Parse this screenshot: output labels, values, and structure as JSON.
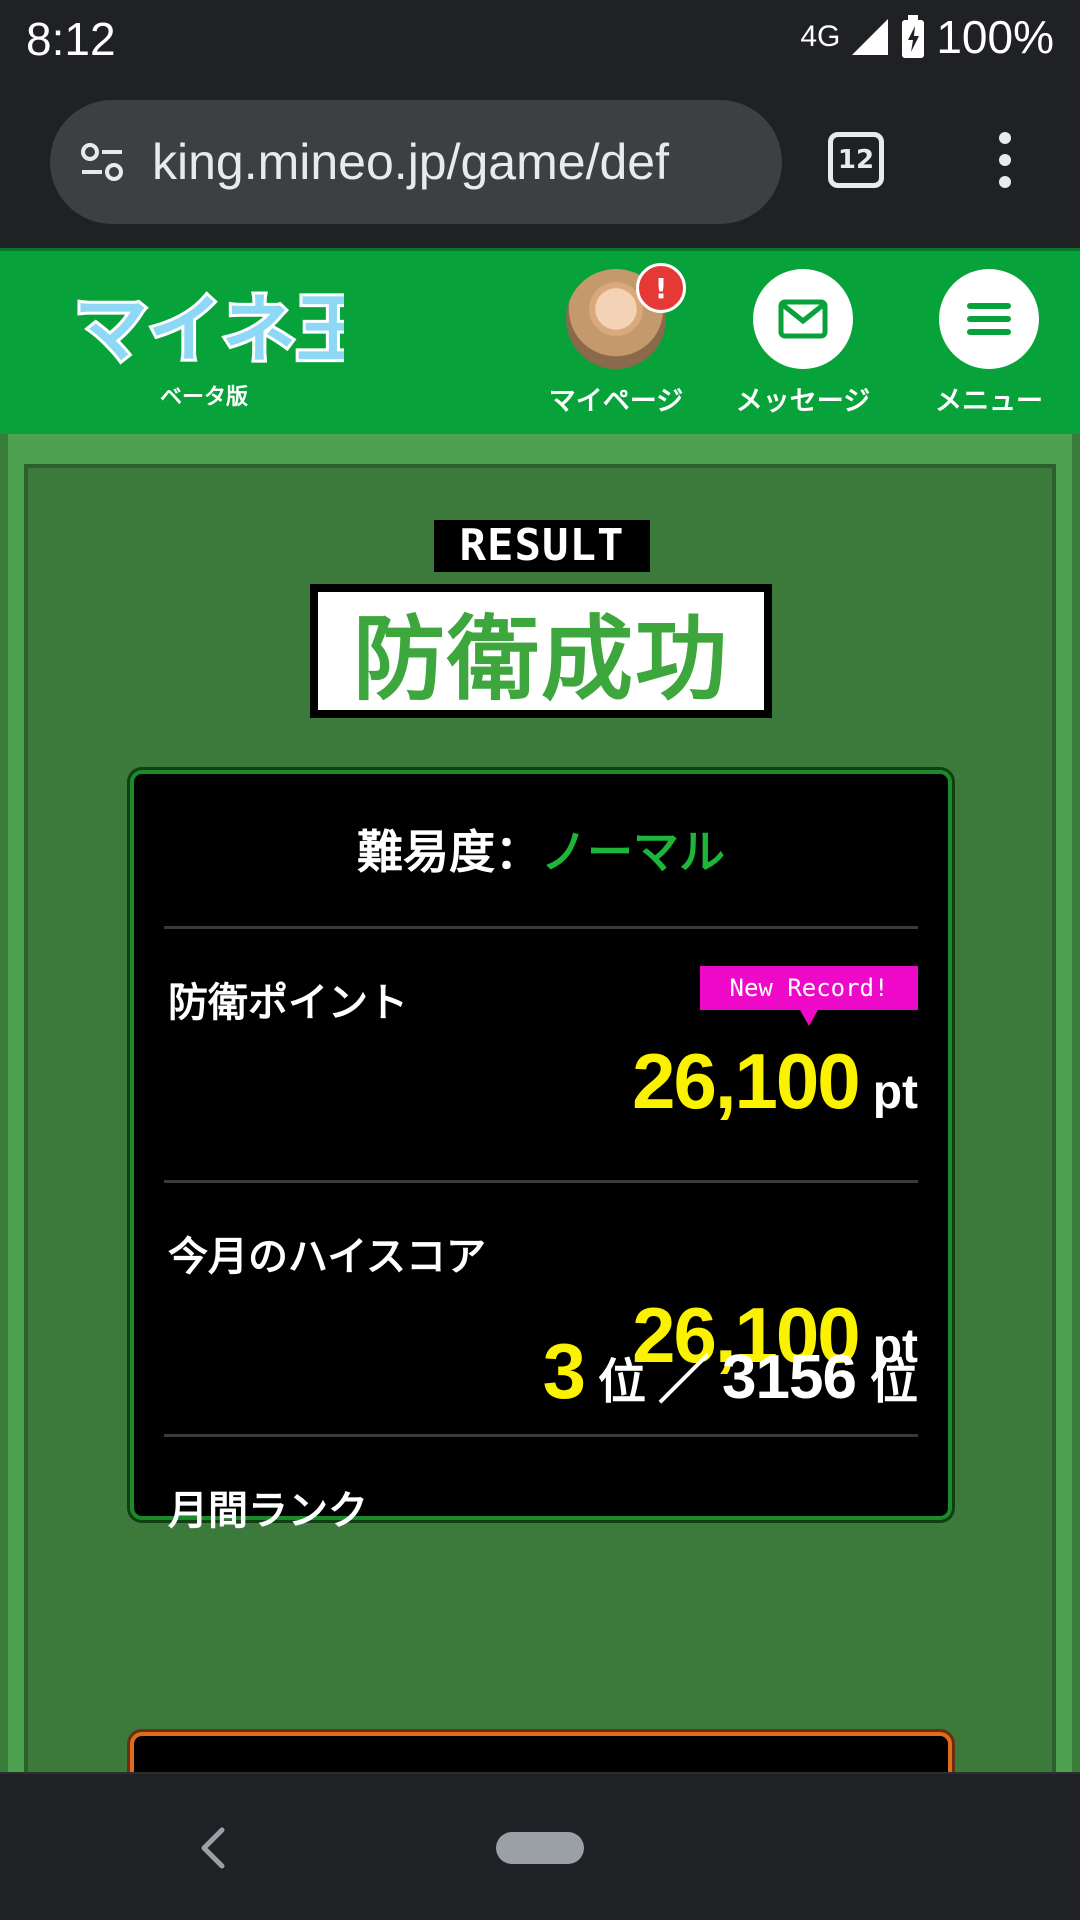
{
  "status_bar": {
    "time": "8:12",
    "network": "4G",
    "battery": "100%"
  },
  "browser": {
    "url": "king.mineo.jp/game/def",
    "tab_count": "12"
  },
  "header": {
    "logo_text": "マイネ王",
    "logo_sub": "ベータ版",
    "nav": [
      {
        "label": "マイページ",
        "badge": "!"
      },
      {
        "label": "メッセージ"
      },
      {
        "label": "メニュー"
      }
    ]
  },
  "result": {
    "label": "RESULT",
    "title": "防衛成功",
    "difficulty_label": "難易度：",
    "difficulty_value": "ノーマル",
    "new_record": "New Record!",
    "rows": [
      {
        "label": "防衛ポイント",
        "value": "26,100",
        "unit": "pt"
      },
      {
        "label": "今月のハイスコア",
        "value": "26,100",
        "unit": "pt"
      },
      {
        "label": "月間ランク",
        "rank": "3",
        "rank_unit": "位",
        "separator": "／",
        "total": "3156",
        "total_unit": "位"
      }
    ]
  },
  "colors": {
    "brand_green": "#08a23a",
    "score_yellow": "#fbf200",
    "record_pink": "#ee09c9",
    "difficulty_green": "#1db63b"
  }
}
